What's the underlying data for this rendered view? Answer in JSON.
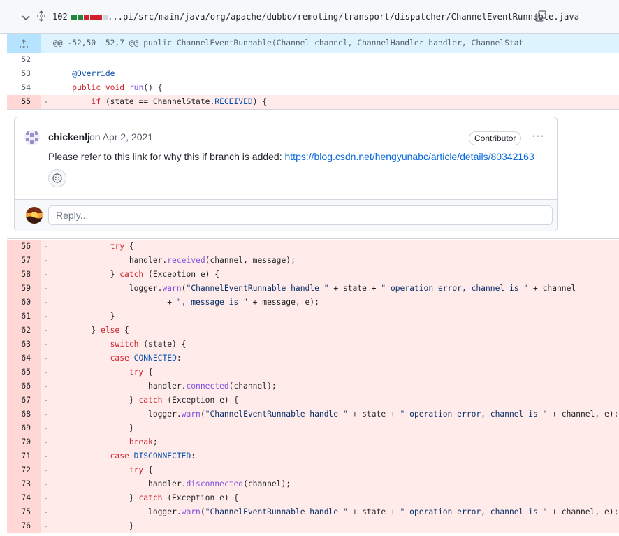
{
  "file": {
    "changes": "102",
    "diffstat_colors": [
      "#1f883d",
      "#1f883d",
      "#cf222e",
      "#cf222e",
      "#cf222e",
      "#d0d7de"
    ],
    "path": "...pi/src/main/java/org/apache/dubbo/remoting/transport/dispatcher/ChannelEventRunnable.java"
  },
  "hunk": {
    "header": "@@ -52,50 +52,7 @@ public ChannelEventRunnable(Channel channel, ChannelHandler handler, ChannelStat"
  },
  "rows_before": [
    {
      "ln": "52",
      "mk": "",
      "type": "ctx",
      "code": []
    },
    {
      "ln": "53",
      "mk": "",
      "type": "ctx",
      "code": [
        [
          "    ",
          ""
        ],
        [
          "@Override",
          "cn"
        ]
      ]
    },
    {
      "ln": "54",
      "mk": "",
      "type": "ctx",
      "code": [
        [
          "    ",
          ""
        ],
        [
          "public",
          "kw"
        ],
        [
          " ",
          ""
        ],
        [
          "void",
          "kw"
        ],
        [
          " ",
          ""
        ],
        [
          "run",
          "fn"
        ],
        [
          "() {",
          ""
        ]
      ]
    },
    {
      "ln": "55",
      "mk": "-",
      "type": "del",
      "code": [
        [
          "        ",
          ""
        ],
        [
          "if",
          "kw"
        ],
        [
          " (state == ChannelState.",
          ""
        ],
        [
          "RECEIVED",
          "cn"
        ],
        [
          ") {",
          ""
        ]
      ]
    }
  ],
  "comment": {
    "author": "chickenlj",
    "date": "on Apr 2, 2021",
    "badge": "Contributor",
    "more": "···",
    "text": "Please refer to this link for why this if branch is added: ",
    "link": "https://blog.csdn.net/hengyunabc/article/details/80342163",
    "reply_placeholder": "Reply..."
  },
  "rows_after": [
    {
      "ln": "56",
      "mk": "-",
      "code": [
        [
          "            ",
          ""
        ],
        [
          "try",
          "kw"
        ],
        [
          " {",
          ""
        ]
      ]
    },
    {
      "ln": "57",
      "mk": "-",
      "code": [
        [
          "                handler.",
          ""
        ],
        [
          "received",
          "fn"
        ],
        [
          "(channel, message);",
          ""
        ]
      ]
    },
    {
      "ln": "58",
      "mk": "-",
      "code": [
        [
          "            } ",
          ""
        ],
        [
          "catch",
          "kw"
        ],
        [
          " (Exception e) {",
          ""
        ]
      ]
    },
    {
      "ln": "59",
      "mk": "-",
      "code": [
        [
          "                logger.",
          ""
        ],
        [
          "warn",
          "fn"
        ],
        [
          "(",
          ""
        ],
        [
          "\"ChannelEventRunnable handle \"",
          "st"
        ],
        [
          " + state + ",
          ""
        ],
        [
          "\" operation error, channel is \"",
          "st"
        ],
        [
          " + channel",
          ""
        ]
      ]
    },
    {
      "ln": "60",
      "mk": "-",
      "code": [
        [
          "                        + ",
          ""
        ],
        [
          "\", message is \"",
          "st"
        ],
        [
          " + message, e);",
          ""
        ]
      ]
    },
    {
      "ln": "61",
      "mk": "-",
      "code": [
        [
          "            }",
          ""
        ]
      ]
    },
    {
      "ln": "62",
      "mk": "-",
      "code": [
        [
          "        } ",
          ""
        ],
        [
          "else",
          "kw"
        ],
        [
          " {",
          ""
        ]
      ]
    },
    {
      "ln": "63",
      "mk": "-",
      "code": [
        [
          "            ",
          ""
        ],
        [
          "switch",
          "kw"
        ],
        [
          " (state) {",
          ""
        ]
      ]
    },
    {
      "ln": "64",
      "mk": "-",
      "code": [
        [
          "            ",
          ""
        ],
        [
          "case",
          "kw"
        ],
        [
          " ",
          ""
        ],
        [
          "CONNECTED",
          "cn"
        ],
        [
          ":",
          ""
        ]
      ]
    },
    {
      "ln": "65",
      "mk": "-",
      "code": [
        [
          "                ",
          ""
        ],
        [
          "try",
          "kw"
        ],
        [
          " {",
          ""
        ]
      ]
    },
    {
      "ln": "66",
      "mk": "-",
      "code": [
        [
          "                    handler.",
          ""
        ],
        [
          "connected",
          "fn"
        ],
        [
          "(channel);",
          ""
        ]
      ]
    },
    {
      "ln": "67",
      "mk": "-",
      "code": [
        [
          "                } ",
          ""
        ],
        [
          "catch",
          "kw"
        ],
        [
          " (Exception e) {",
          ""
        ]
      ]
    },
    {
      "ln": "68",
      "mk": "-",
      "code": [
        [
          "                    logger.",
          ""
        ],
        [
          "warn",
          "fn"
        ],
        [
          "(",
          ""
        ],
        [
          "\"ChannelEventRunnable handle \"",
          "st"
        ],
        [
          " + state + ",
          ""
        ],
        [
          "\" operation error, channel is \"",
          "st"
        ],
        [
          " + channel, e);",
          ""
        ]
      ]
    },
    {
      "ln": "69",
      "mk": "-",
      "code": [
        [
          "                }",
          ""
        ]
      ]
    },
    {
      "ln": "70",
      "mk": "-",
      "code": [
        [
          "                ",
          ""
        ],
        [
          "break",
          "kw"
        ],
        [
          ";",
          ""
        ]
      ]
    },
    {
      "ln": "71",
      "mk": "-",
      "code": [
        [
          "            ",
          ""
        ],
        [
          "case",
          "kw"
        ],
        [
          " ",
          ""
        ],
        [
          "DISCONNECTED",
          "cn"
        ],
        [
          ":",
          ""
        ]
      ]
    },
    {
      "ln": "72",
      "mk": "-",
      "code": [
        [
          "                ",
          ""
        ],
        [
          "try",
          "kw"
        ],
        [
          " {",
          ""
        ]
      ]
    },
    {
      "ln": "73",
      "mk": "-",
      "code": [
        [
          "                    handler.",
          ""
        ],
        [
          "disconnected",
          "fn"
        ],
        [
          "(channel);",
          ""
        ]
      ]
    },
    {
      "ln": "74",
      "mk": "-",
      "code": [
        [
          "                } ",
          ""
        ],
        [
          "catch",
          "kw"
        ],
        [
          " (Exception e) {",
          ""
        ]
      ]
    },
    {
      "ln": "75",
      "mk": "-",
      "code": [
        [
          "                    logger.",
          ""
        ],
        [
          "warn",
          "fn"
        ],
        [
          "(",
          ""
        ],
        [
          "\"ChannelEventRunnable handle \"",
          "st"
        ],
        [
          " + state + ",
          ""
        ],
        [
          "\" operation error, channel is \"",
          "st"
        ],
        [
          " + channel, e);",
          ""
        ]
      ]
    },
    {
      "ln": "76",
      "mk": "-",
      "code": [
        [
          "                }",
          ""
        ]
      ]
    }
  ]
}
